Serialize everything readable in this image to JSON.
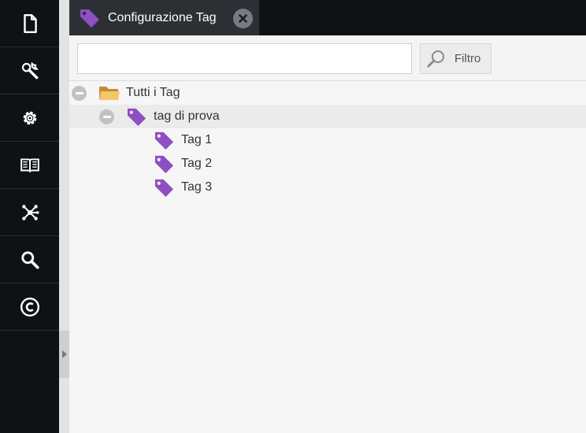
{
  "sidebar": {
    "items": [
      {
        "icon": "document-icon"
      },
      {
        "icon": "wrench-icon"
      },
      {
        "icon": "gear-icon"
      },
      {
        "icon": "book-icon"
      },
      {
        "icon": "network-icon"
      },
      {
        "icon": "search-icon"
      },
      {
        "icon": "copyright-icon"
      }
    ]
  },
  "tab": {
    "title": "Configurazione Tag",
    "icon": "tag-icon"
  },
  "toolbar": {
    "search_value": "",
    "filter_label": "Filtro"
  },
  "tree": {
    "root": {
      "label": "Tutti i Tag",
      "icon": "folder-icon"
    },
    "group": {
      "label": "tag di prova",
      "icon": "tag-icon"
    },
    "items": [
      {
        "label": "Tag 1"
      },
      {
        "label": "Tag 2"
      },
      {
        "label": "Tag 3"
      }
    ]
  },
  "colors": {
    "sidebar_bg": "#0f1215",
    "tab_bg": "#2c3035",
    "tag_purple": "#8e4fc2",
    "folder_orange": "#e7a84c"
  }
}
